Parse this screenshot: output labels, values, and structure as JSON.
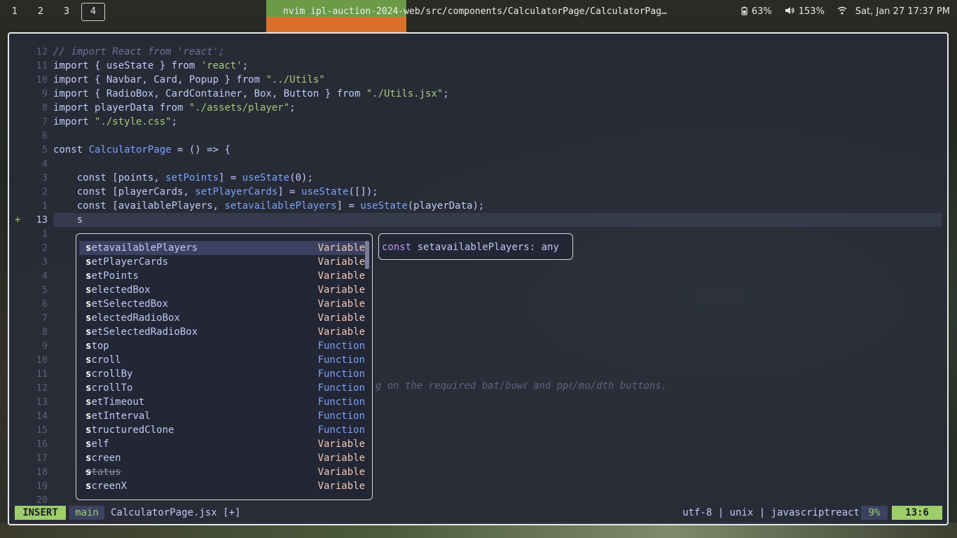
{
  "topbar": {
    "workspaces": [
      "1",
      "2",
      "3",
      "4"
    ],
    "active_workspace": "4",
    "window_title": "nvim ipl-auction-2024-web/src/components/CalculatorPage/CalculatorPag…",
    "battery": "63%",
    "volume": "153%",
    "datetime": "Sat, Jan 27 17:37 PM"
  },
  "editor": {
    "lines": [
      {
        "num": "12",
        "sign": "",
        "html": "<span class='cm'>// import React from 'react';</span>"
      },
      {
        "num": "11",
        "sign": "",
        "html": "import { useState } from <span class='str'>'react'</span>;"
      },
      {
        "num": "10",
        "sign": "",
        "html": "import { Navbar, Card, Popup } from <span class='str'>\"../Utils\"</span>"
      },
      {
        "num": "9",
        "sign": "",
        "html": "import { RadioBox, CardContainer, Box, Button } from <span class='str'>\"./Utils.jsx\"</span>;"
      },
      {
        "num": "8",
        "sign": "",
        "html": "import playerData from <span class='str'>\"./assets/player\"</span>;"
      },
      {
        "num": "7",
        "sign": "",
        "html": "import <span class='str'>\"./style.css\"</span>;"
      },
      {
        "num": "6",
        "sign": "",
        "html": ""
      },
      {
        "num": "5",
        "sign": "",
        "html": "const <span class='fn'>CalculatorPage</span> = () => {"
      },
      {
        "num": "4",
        "sign": "",
        "html": ""
      },
      {
        "num": "3",
        "sign": "",
        "html": "    const [points, <span class='fn'>setPoints</span>] = <span class='fn'>useState</span>(0);"
      },
      {
        "num": "2",
        "sign": "",
        "html": "    const [playerCards, <span class='fn'>setPlayerCards</span>] = <span class='fn'>useState</span>([]);"
      },
      {
        "num": "1",
        "sign": "",
        "html": "    const [availablePlayers, <span class='fn'>setavailablePlayers</span>] = <span class='fn'>useState</span>(playerData);"
      },
      {
        "num": "13",
        "sign": "+",
        "html": "    s"
      },
      {
        "num": "1",
        "sign": "",
        "html": ""
      },
      {
        "num": "2",
        "sign": "",
        "html": ""
      },
      {
        "num": "3",
        "sign": "",
        "html": ""
      },
      {
        "num": "4",
        "sign": "",
        "html": ""
      },
      {
        "num": "5",
        "sign": "",
        "html": ""
      },
      {
        "num": "6",
        "sign": "",
        "html": ""
      },
      {
        "num": "7",
        "sign": "",
        "html": ""
      },
      {
        "num": "8",
        "sign": "",
        "html": ""
      },
      {
        "num": "9",
        "sign": "",
        "html": ""
      },
      {
        "num": "10",
        "sign": "",
        "html": ""
      },
      {
        "num": "11",
        "sign": "",
        "html": ""
      },
      {
        "num": "12",
        "sign": "",
        "html": ""
      },
      {
        "num": "13",
        "sign": "",
        "html": ""
      },
      {
        "num": "14",
        "sign": "",
        "html": ""
      },
      {
        "num": "15",
        "sign": "",
        "html": ""
      },
      {
        "num": "16",
        "sign": "",
        "html": ""
      },
      {
        "num": "17",
        "sign": "",
        "html": ""
      },
      {
        "num": "18",
        "sign": "",
        "html": ""
      },
      {
        "num": "19",
        "sign": "",
        "html": ""
      },
      {
        "num": "20",
        "sign": "",
        "html": ""
      }
    ],
    "ghost_text": "g on the required bat/bowℓ and ppℓ/mo/dth buttons."
  },
  "completion": {
    "items": [
      {
        "prefix": "s",
        "rest": "etavailablePlayers",
        "kind": "Variable",
        "selected": true,
        "deprecated": false
      },
      {
        "prefix": "s",
        "rest": "etPlayerCards",
        "kind": "Variable",
        "selected": false,
        "deprecated": false
      },
      {
        "prefix": "s",
        "rest": "etPoints",
        "kind": "Variable",
        "selected": false,
        "deprecated": false
      },
      {
        "prefix": "s",
        "rest": "electedBox",
        "kind": "Variable",
        "selected": false,
        "deprecated": false
      },
      {
        "prefix": "s",
        "rest": "etSelectedBox",
        "kind": "Variable",
        "selected": false,
        "deprecated": false
      },
      {
        "prefix": "s",
        "rest": "electedRadioBox",
        "kind": "Variable",
        "selected": false,
        "deprecated": false
      },
      {
        "prefix": "s",
        "rest": "etSelectedRadioBox",
        "kind": "Variable",
        "selected": false,
        "deprecated": false
      },
      {
        "prefix": "s",
        "rest": "top",
        "kind": "Function",
        "selected": false,
        "deprecated": false
      },
      {
        "prefix": "s",
        "rest": "croll",
        "kind": "Function",
        "selected": false,
        "deprecated": false
      },
      {
        "prefix": "s",
        "rest": "crollBy",
        "kind": "Function",
        "selected": false,
        "deprecated": false
      },
      {
        "prefix": "s",
        "rest": "crollTo",
        "kind": "Function",
        "selected": false,
        "deprecated": false
      },
      {
        "prefix": "s",
        "rest": "etTimeout",
        "kind": "Function",
        "selected": false,
        "deprecated": false
      },
      {
        "prefix": "s",
        "rest": "etInterval",
        "kind": "Function",
        "selected": false,
        "deprecated": false
      },
      {
        "prefix": "s",
        "rest": "tructuredClone",
        "kind": "Function",
        "selected": false,
        "deprecated": false
      },
      {
        "prefix": "s",
        "rest": "elf",
        "kind": "Variable",
        "selected": false,
        "deprecated": false
      },
      {
        "prefix": "s",
        "rest": "creen",
        "kind": "Variable",
        "selected": false,
        "deprecated": false
      },
      {
        "prefix": "s",
        "rest": "tatus",
        "kind": "Variable",
        "selected": false,
        "deprecated": true
      },
      {
        "prefix": "s",
        "rest": "creenX",
        "kind": "Variable",
        "selected": false,
        "deprecated": false
      }
    ],
    "doc_keyword": "const",
    "doc_text": " setavailablePlayers: any"
  },
  "statusline": {
    "mode": "INSERT",
    "branch": "main",
    "filename": "CalculatorPage.jsx [+]",
    "info": "utf-8 | unix | javascriptreact",
    "percent": "9%",
    "position": "13:6"
  },
  "colors": {
    "accent": "#9ece6a",
    "function": "#7aa2f7",
    "string": "#a6c97a",
    "variable_kind": "#f2c9b8"
  }
}
